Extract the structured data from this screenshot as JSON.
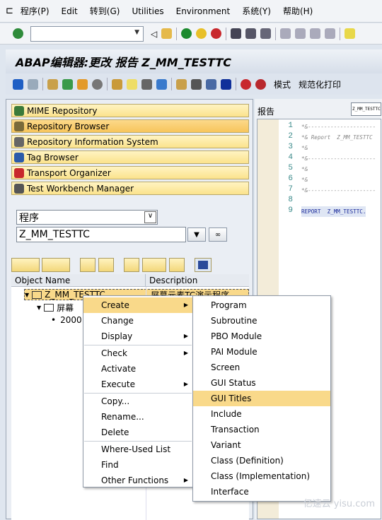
{
  "menubar": {
    "items": [
      "程序(P)",
      "Edit",
      "转到(G)",
      "Utilities",
      "Environment",
      "系统(Y)",
      "帮助(H)"
    ]
  },
  "title": "ABAP编辑器:更改 报告 Z_MM_TESTTC",
  "apptoolbar": {
    "mode": "模式",
    "pretty_print": "规范化打印"
  },
  "nav": [
    "MIME Repository",
    "Repository Browser",
    "Repository Information System",
    "Tag Browser",
    "Transport Organizer",
    "Test Workbench Manager"
  ],
  "object_type": "程序",
  "object_name": "Z_MM_TESTTC",
  "tree": {
    "headers": [
      "Object Name",
      "Description"
    ],
    "root": "Z_MM_TESTTC",
    "root_desc": "屏幕元素TC演示程序",
    "child": "屏幕",
    "leaf": "2000"
  },
  "editor": {
    "label": "报告",
    "program": "Z_MM_TESTTC",
    "lines": [
      "*&---------------------",
      "*& Report  Z_MM_TESTTC",
      "*&",
      "*&---------------------",
      "*&",
      "*&",
      "*&---------------------",
      "",
      "REPORT  Z_MM_TESTTC."
    ]
  },
  "context_menu": [
    {
      "label": "Create",
      "sub": true,
      "hl": true
    },
    {
      "label": "Change"
    },
    {
      "label": "Display",
      "sub": true
    },
    {
      "sep": true
    },
    {
      "label": "Check",
      "sub": true
    },
    {
      "label": "Activate"
    },
    {
      "label": "Execute",
      "sub": true
    },
    {
      "sep": true
    },
    {
      "label": "Copy..."
    },
    {
      "label": "Rename..."
    },
    {
      "label": "Delete"
    },
    {
      "sep": true
    },
    {
      "label": "Where-Used List"
    },
    {
      "label": "Find"
    },
    {
      "label": "Other Functions",
      "sub": true
    }
  ],
  "create_submenu": [
    {
      "label": "Program"
    },
    {
      "label": "Subroutine"
    },
    {
      "label": "PBO Module"
    },
    {
      "label": "PAI Module"
    },
    {
      "label": "Screen"
    },
    {
      "label": "GUI Status"
    },
    {
      "label": "GUI Titles",
      "hl": true
    },
    {
      "label": "Include"
    },
    {
      "label": "Transaction"
    },
    {
      "label": "Variant"
    },
    {
      "label": "Class (Definition)"
    },
    {
      "label": "Class (Implementation)"
    },
    {
      "label": "Interface"
    }
  ],
  "watermark": "亿速云 yisu.com"
}
